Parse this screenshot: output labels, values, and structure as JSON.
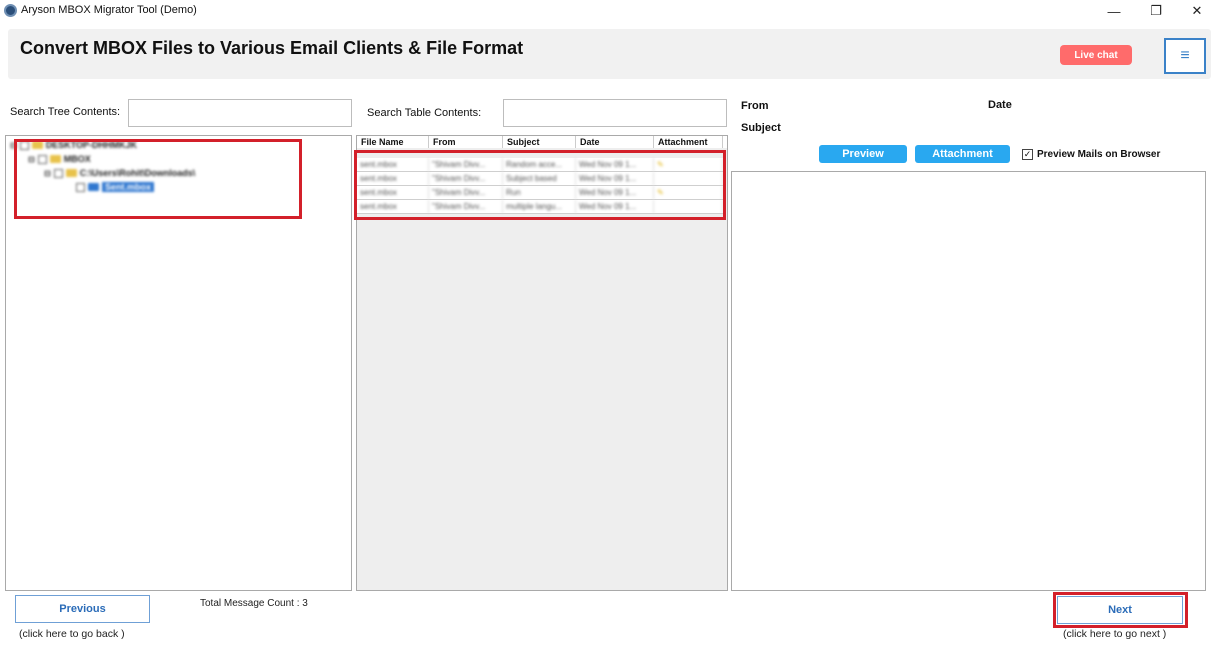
{
  "window": {
    "title": "Aryson MBOX Migrator Tool (Demo)",
    "minimize_icon": "minimize-icon",
    "restore_icon": "restore-icon",
    "close_icon": "close-icon"
  },
  "header": {
    "title": "Convert MBOX Files to Various Email Clients & File Format",
    "live_chat": "Live chat",
    "menu_icon": "hamburger-menu-icon"
  },
  "tree": {
    "search_label": "Search Tree Contents:",
    "search_value": "",
    "nodes": [
      {
        "label": "DESKTOP-DHHMKJK",
        "checked": true
      },
      {
        "label": "MBOX",
        "checked": true
      },
      {
        "label": "C:\\Users\\Rohit\\Downloads\\",
        "checked": true
      },
      {
        "label": "Sent.mbox",
        "checked": false
      }
    ]
  },
  "table": {
    "search_label": "Search Table Contents:",
    "search_value": "",
    "columns": [
      "File Name",
      "From",
      "Subject",
      "Date",
      "Attachment"
    ],
    "rows": [
      [
        "sent.mbox",
        "\"Shivam Divv...",
        "Random acce...",
        "Wed Nov 09 1...",
        "clip"
      ],
      [
        "sent.mbox",
        "\"Shivam Divv...",
        "Subject based",
        "Wed Nov 09 1...",
        ""
      ],
      [
        "sent.mbox",
        "\"Shivam Divv...",
        "Run",
        "Wed Nov 09 1...",
        "clip"
      ],
      [
        "sent.mbox",
        "\"Shivam Divv...",
        "multiple langu...",
        "Wed Nov 09 1...",
        ""
      ]
    ]
  },
  "preview": {
    "from_label": "From",
    "date_label": "Date",
    "subject_label": "Subject",
    "preview_button": "Preview",
    "attachment_button": "Attachment",
    "browser_checkbox_label": "Preview Mails on Browser",
    "browser_checked": true
  },
  "footer": {
    "previous_label": "Previous",
    "previous_hint": "(click here to  go back )",
    "message_count": "Total Message Count : 3",
    "next_label": "Next",
    "next_hint": "(click here to  go next )"
  },
  "colors": {
    "accent_blue": "#29a8f0",
    "live_chat": "#ff6b6b",
    "highlight_red": "#d3202a"
  }
}
